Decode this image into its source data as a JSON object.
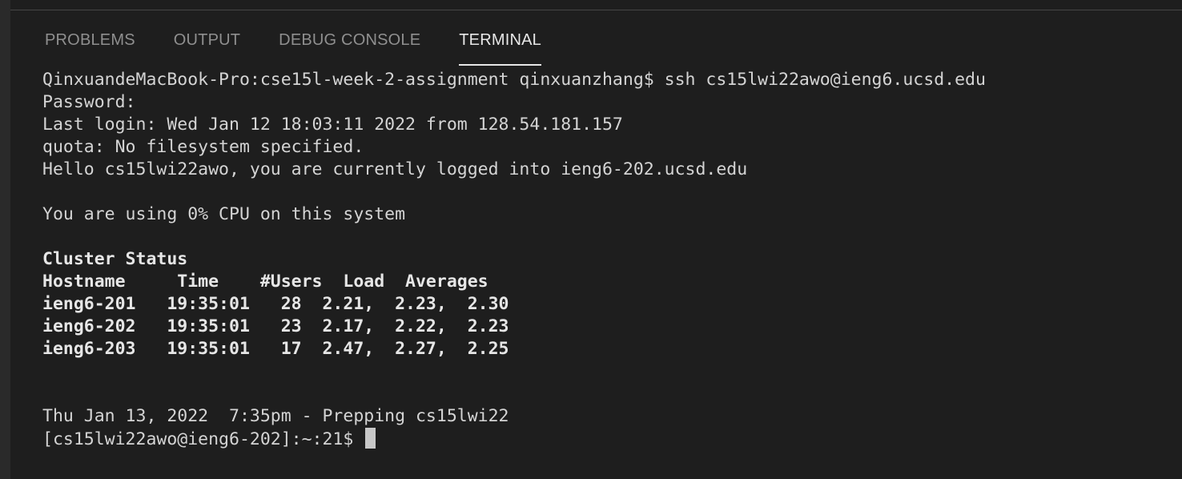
{
  "panel": {
    "tabs": [
      {
        "label": "PROBLEMS"
      },
      {
        "label": "OUTPUT"
      },
      {
        "label": "DEBUG CONSOLE"
      },
      {
        "label": "TERMINAL",
        "active": true
      }
    ]
  },
  "terminal": {
    "lines": [
      "QinxuandeMacBook-Pro:cse15l-week-2-assignment qinxuanzhang$ ssh cs15lwi22awo@ieng6.ucsd.edu",
      "Password:",
      "Last login: Wed Jan 12 18:03:11 2022 from 128.54.181.157",
      "quota: No filesystem specified.",
      "Hello cs15lwi22awo, you are currently logged into ieng6-202.ucsd.edu",
      "",
      "You are using 0% CPU on this system",
      "",
      "Cluster Status",
      "Hostname     Time    #Users  Load  Averages",
      "ieng6-201   19:35:01   28  2.21,  2.23,  2.30",
      "ieng6-202   19:35:01   23  2.17,  2.22,  2.23",
      "ieng6-203   19:35:01   17  2.47,  2.27,  2.25",
      "",
      "",
      "Thu Jan 13, 2022  7:35pm - Prepping cs15lwi22"
    ],
    "prompt": "[cs15lwi22awo@ieng6-202]:~:21$ "
  }
}
